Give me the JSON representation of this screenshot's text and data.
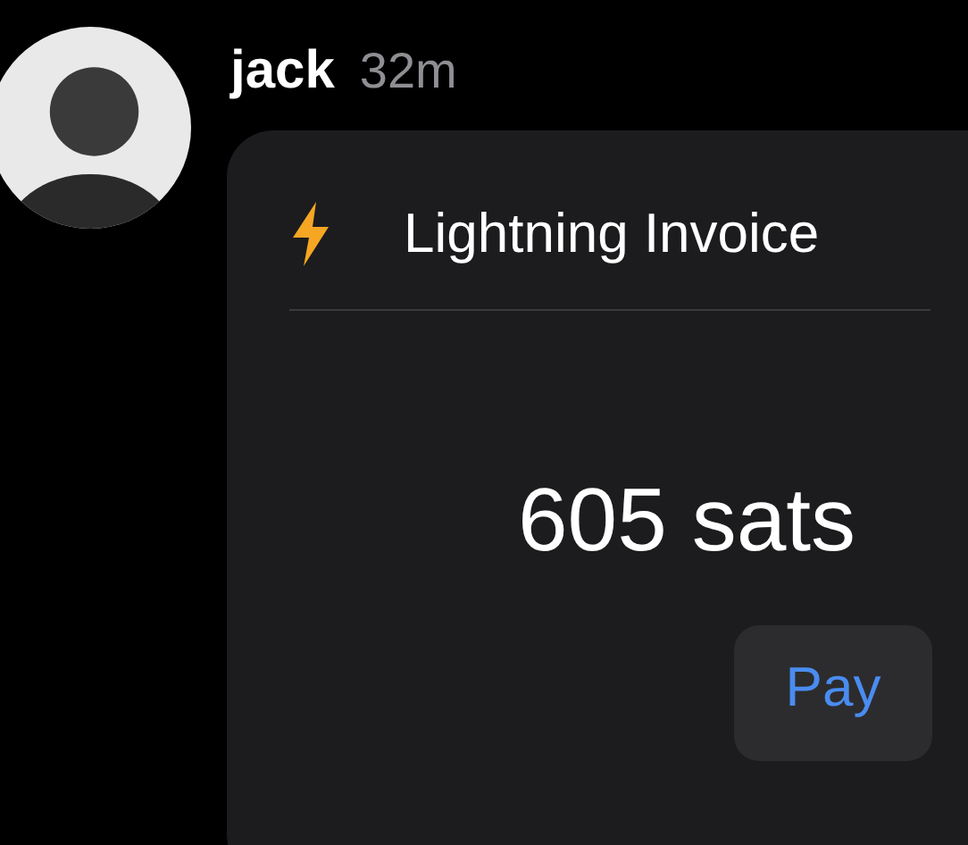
{
  "post": {
    "author": "jack",
    "time": "32m"
  },
  "invoice": {
    "title": "Lightning Invoice",
    "amount": "605 sats",
    "button": "Pay"
  }
}
